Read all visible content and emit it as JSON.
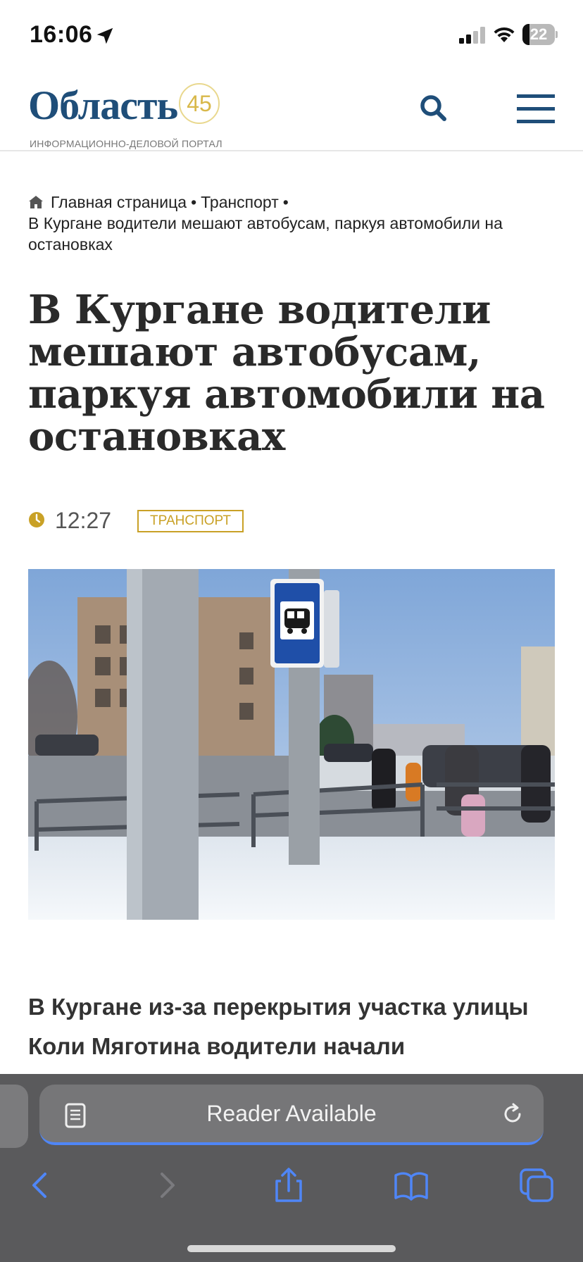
{
  "status_bar": {
    "time": "16:06",
    "battery_level": "22",
    "battery_fraction": 0.22,
    "icons": [
      "location-arrow-icon",
      "cellular-signal-icon",
      "wifi-icon",
      "battery-icon"
    ]
  },
  "header": {
    "logo_word": "Область",
    "logo_badge": "45",
    "logo_subtitle": "ИНФОРМАЦИОННО-ДЕЛОВОЙ ПОРТАЛ",
    "icons": [
      "search-icon",
      "hamburger-menu-icon"
    ],
    "brand_color": "#1f4e79",
    "accent_color": "#c9a126"
  },
  "breadcrumb": {
    "home_label": "Главная страница",
    "section_label": "Транспорт",
    "current_label": "В Кургане водители мешают автобусам, паркуя автомобили на остановках",
    "separator": "•"
  },
  "article": {
    "title": "В Кургане водители мешают автобусам, паркуя автомобили на остановках",
    "time": "12:27",
    "tag": "ТРАНСПОРТ",
    "lead": "В Кургане из-за перекрытия участка улицы Коли Мяготина водители начали"
  },
  "safari": {
    "address_text": "Reader Available",
    "icons": [
      "reader-icon",
      "reload-icon",
      "back-icon",
      "forward-icon",
      "share-icon",
      "bookmarks-icon",
      "tabs-icon"
    ],
    "toolbar_color": "#5a5a5c",
    "link_color": "#4f86f7"
  }
}
